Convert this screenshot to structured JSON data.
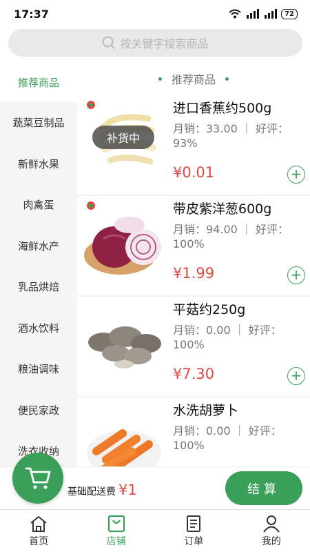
{
  "status_bar": {
    "time": "17:37",
    "battery": "72"
  },
  "search": {
    "placeholder": "按关键字搜索商品"
  },
  "sidebar": {
    "items": [
      {
        "label": "推荐商品",
        "active": true
      },
      {
        "label": "蔬菜豆制品"
      },
      {
        "label": "新鲜水果"
      },
      {
        "label": "肉禽蛋"
      },
      {
        "label": "海鲜水产"
      },
      {
        "label": "乳品烘焙"
      },
      {
        "label": "酒水饮料"
      },
      {
        "label": "粮油调味"
      },
      {
        "label": "便民家政"
      },
      {
        "label": "洗衣收纳"
      }
    ]
  },
  "main": {
    "section_title": "推荐商品",
    "products": [
      {
        "name": "进口香蕉约500g",
        "meta": "月销：33.00 ｜ 好评：93%",
        "price": "¥0.01",
        "badge": "补货中",
        "image": "banana"
      },
      {
        "name": "带皮紫洋葱600g",
        "meta": "月销：94.00 ｜ 好评：100%",
        "price": "¥1.99",
        "image": "onion"
      },
      {
        "name": "平菇约250g",
        "meta": "月销：0.00 ｜ 好评：100%",
        "price": "¥7.30",
        "image": "mushroom"
      },
      {
        "name": "水洗胡萝卜",
        "meta": "月销：0.00 ｜ 好评：100%",
        "price": "",
        "image": "carrot"
      }
    ],
    "add_symbol": "+"
  },
  "cart": {
    "delivery_label": "基础配送费",
    "delivery_fee": "¥1",
    "checkout_label": "结算"
  },
  "tabbar": {
    "items": [
      {
        "label": "首页",
        "icon": "home-icon"
      },
      {
        "label": "店铺",
        "icon": "shop-icon",
        "active": true
      },
      {
        "label": "订单",
        "icon": "orders-icon"
      },
      {
        "label": "我的",
        "icon": "profile-icon"
      }
    ]
  },
  "colors": {
    "accent": "#3a9f58",
    "price": "#e24640"
  }
}
